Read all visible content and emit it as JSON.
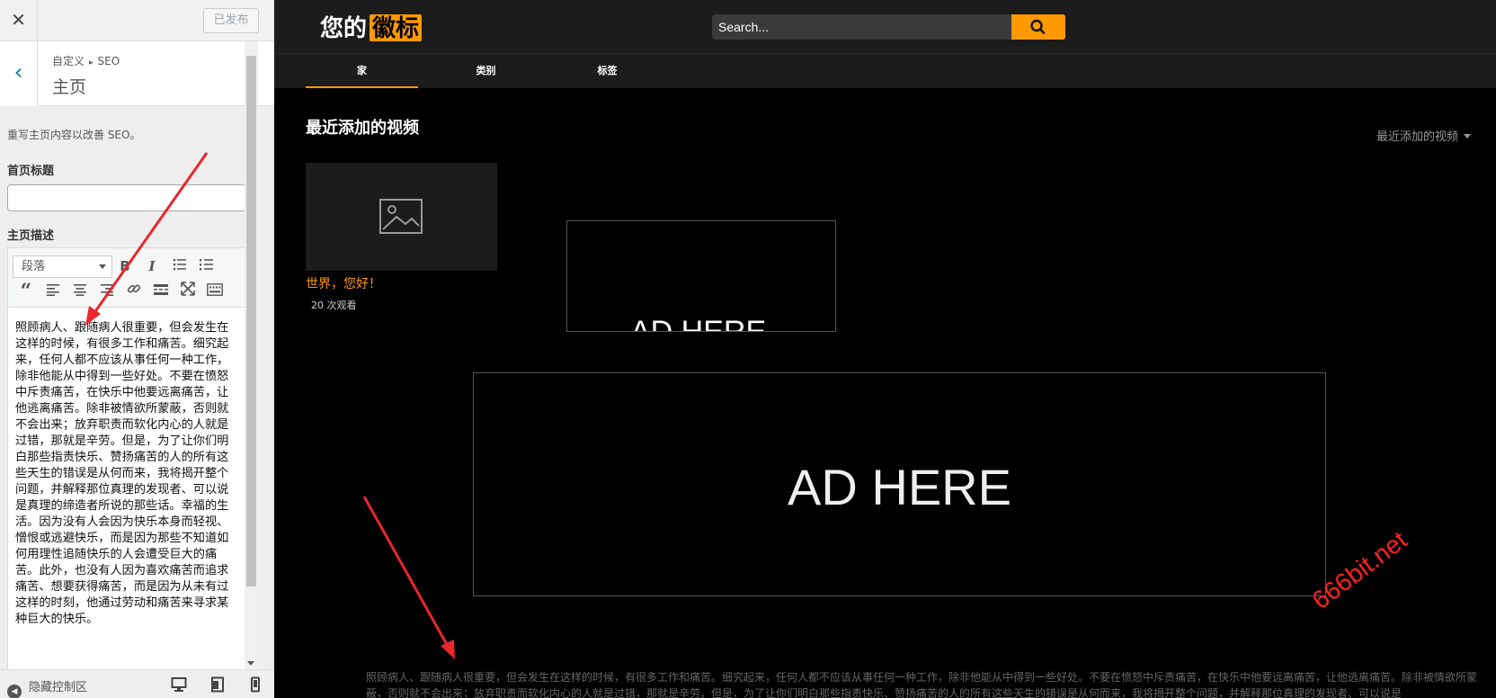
{
  "customizer": {
    "close_icon": "close-icon",
    "publish_label": "已发布",
    "breadcrumb_parent": "自定义",
    "breadcrumb_child": "SEO",
    "section_title": "主页",
    "description": "重写主页内容以改善 SEO。",
    "home_title_label": "首页标题",
    "home_title_value": "",
    "home_desc_label": "主页描述",
    "editor": {
      "format_select": "段落",
      "toolbar_icons": [
        "bold-icon",
        "italic-icon",
        "bullet-list-icon",
        "numbered-list-icon",
        "blockquote-icon",
        "align-left-icon",
        "align-center-icon",
        "align-right-icon",
        "link-icon",
        "read-more-icon",
        "fullscreen-icon",
        "toolbar-toggle-icon"
      ],
      "content": "照顾病人、跟随病人很重要，但会发生在这样的时候，有很多工作和痛苦。细究起来，任何人都不应该从事任何一种工作，除非他能从中得到一些好处。不要在愤怒中斥责痛苦，在快乐中他要远离痛苦，让他逃离痛苦。除非被情欲所蒙蔽，否则就不会出来；放弃职责而软化内心的人就是过错，那就是辛劳。但是，为了让你们明白那些指责快乐、赞扬痛苦的人的所有这些天生的错误是从何而来，我将揭开整个问题，并解释那位真理的发现者、可以说是真理的缔造者所说的那些话。幸福的生活。因为没有人会因为快乐本身而轻视、憎恨或逃避快乐，而是因为那些不知道如何用理性追随快乐的人会遭受巨大的痛苦。此外，也没有人因为喜欢痛苦而追求痛苦、想要获得痛苦，而是因为从未有过这样的时刻，他通过劳动和痛苦来寻求某种巨大的快乐。"
    },
    "footer": {
      "hide_controls_label": "隐藏控制区",
      "devices": [
        "desktop-icon",
        "tablet-icon",
        "mobile-icon"
      ]
    }
  },
  "site": {
    "logo_text": "您的",
    "logo_highlight": "徽标",
    "search_placeholder": "Search...",
    "nav": [
      "家",
      "类别",
      "标签"
    ],
    "section_title": "最近添加的视频",
    "sort_label": "最近添加的视频",
    "video": {
      "title": "世界，您好！",
      "views": "20 次观看"
    },
    "ad_small_text": "AD HERE",
    "ad_big_text": "AD HERE",
    "footer_desc": "照顾病人、跟随病人很重要，但会发生在这样的时候，有很多工作和痛苦。细究起来，任何人都不应该从事任何一种工作，除非他能从中得到一些好处。不要在愤怒中斥责痛苦，在快乐中他要远离痛苦，让他逃离痛苦。除非被情欲所蒙蔽，否则就不会出来；放弃职责而软化内心的人就是过错，那就是辛劳。但是，为了让你们明白那些指责快乐、赞扬痛苦的人的所有这些天生的错误是从何而来，我将揭开整个问题，并解释那位真理的发现者、可以说是"
  },
  "watermark": "666bit.net",
  "colors": {
    "accent": "#ff9900",
    "arrow": "#e8272e",
    "link_blue": "#0073aa"
  }
}
